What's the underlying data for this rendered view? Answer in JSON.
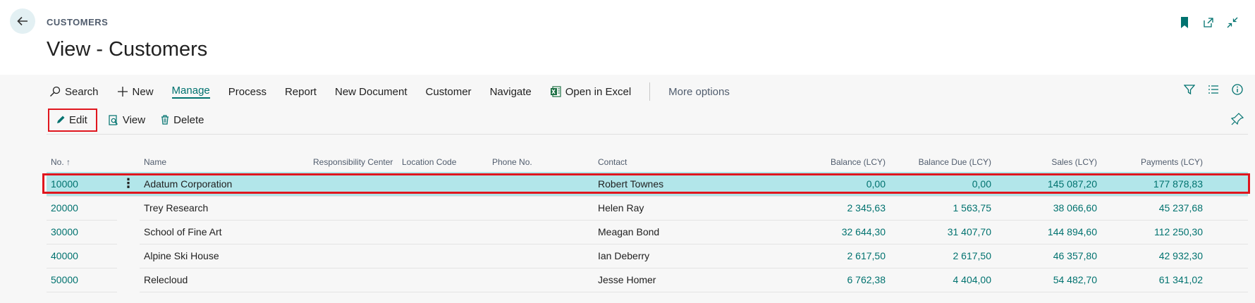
{
  "header": {
    "breadcrumb": "CUSTOMERS",
    "title": "View - Customers",
    "icons": [
      "back-arrow-icon",
      "bookmark-icon",
      "open-new-window-icon",
      "collapse-icon"
    ]
  },
  "toolbar": {
    "search": "Search",
    "new": "New",
    "manage": "Manage",
    "process": "Process",
    "report": "Report",
    "new_document": "New Document",
    "customer": "Customer",
    "navigate": "Navigate",
    "open_in_excel": "Open in Excel",
    "more_options": "More options"
  },
  "actions": {
    "edit": "Edit",
    "view": "View",
    "delete": "Delete"
  },
  "table": {
    "columns": {
      "no": "No. ↑",
      "name": "Name",
      "responsibility_center": "Responsibility Center",
      "location_code": "Location Code",
      "phone_no": "Phone No.",
      "contact": "Contact",
      "balance": "Balance (LCY)",
      "balance_due": "Balance Due (LCY)",
      "sales": "Sales (LCY)",
      "payments": "Payments (LCY)"
    },
    "rows": [
      {
        "no": "10000",
        "name": "Adatum Corporation",
        "contact": "Robert Townes",
        "balance": "0,00",
        "balance_due": "0,00",
        "sales": "145 087,20",
        "payments": "177 878,83"
      },
      {
        "no": "20000",
        "name": "Trey Research",
        "contact": "Helen Ray",
        "balance": "2 345,63",
        "balance_due": "1 563,75",
        "sales": "38 066,60",
        "payments": "45 237,68"
      },
      {
        "no": "30000",
        "name": "School of Fine Art",
        "contact": "Meagan Bond",
        "balance": "32 644,30",
        "balance_due": "31 407,70",
        "sales": "144 894,60",
        "payments": "112 250,30"
      },
      {
        "no": "40000",
        "name": "Alpine Ski House",
        "contact": "Ian Deberry",
        "balance": "2 617,50",
        "balance_due": "2 617,50",
        "sales": "46 357,80",
        "payments": "42 932,30"
      },
      {
        "no": "50000",
        "name": "Relecloud",
        "contact": "Jesse Homer",
        "balance": "6 762,38",
        "balance_due": "4 404,00",
        "sales": "54 482,70",
        "payments": "61 341,02"
      }
    ],
    "row_menu": "⋮"
  },
  "colors": {
    "accent": "#00726f",
    "selected_row": "#b2e6ea",
    "highlight_outline": "#e0161e"
  }
}
